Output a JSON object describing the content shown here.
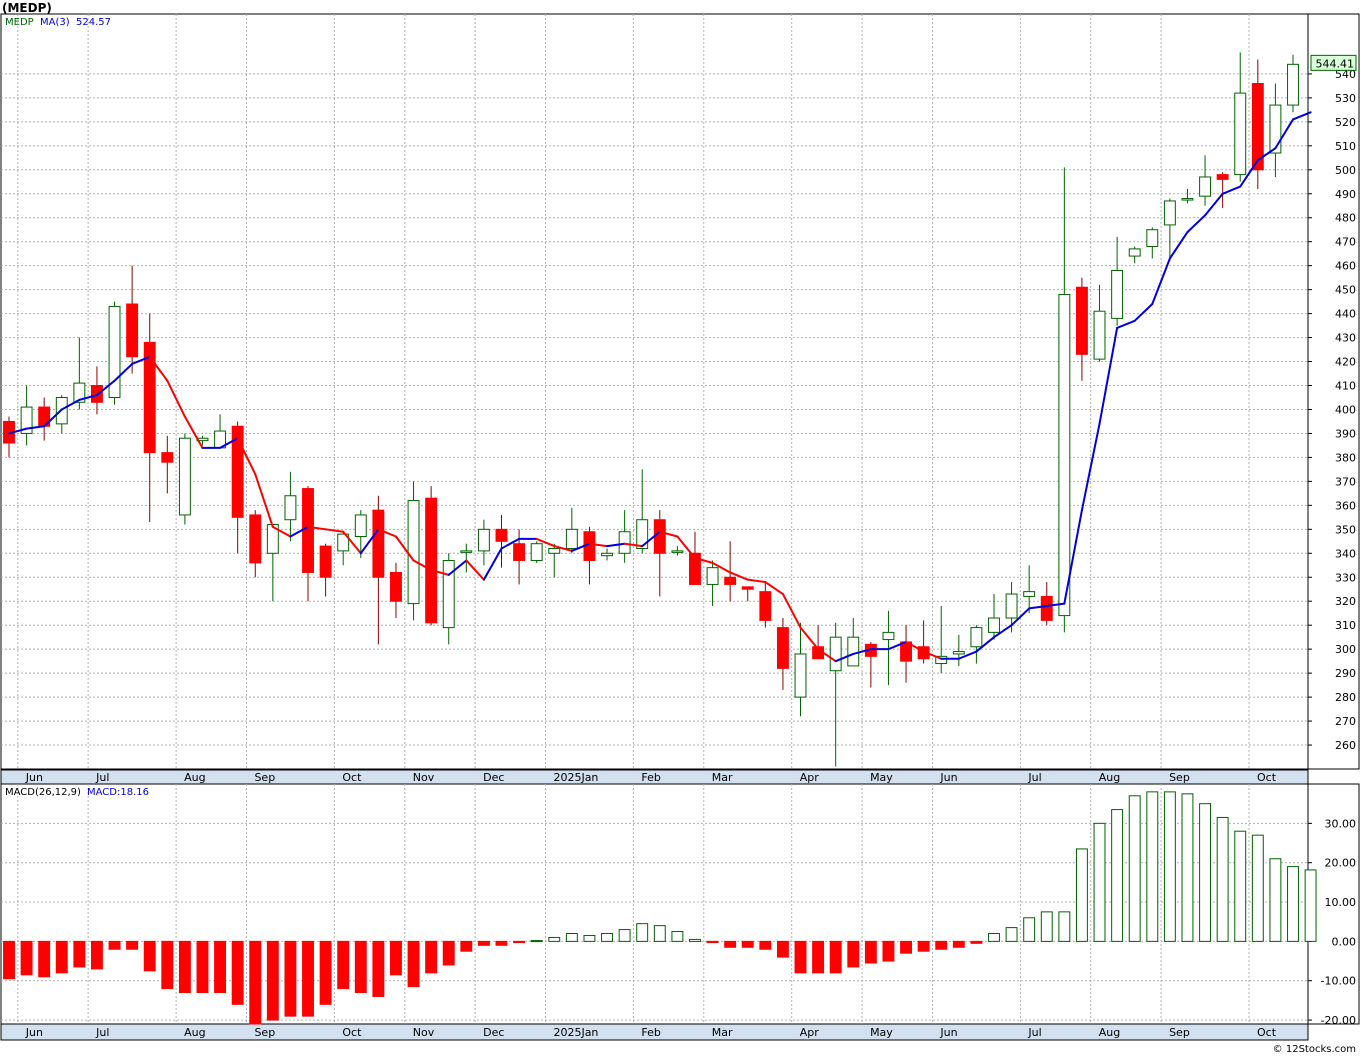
{
  "symbol_title": "(MEDP)",
  "credit": "© 12Stocks.com",
  "colors": {
    "up": "#006400",
    "down": "#ff0000",
    "ma_up": "#0000dd",
    "ma_down": "#ff0000",
    "grid": "#b0b0b0",
    "axis_band": "#d3e0f0",
    "last_price_box": "#d8ffd8"
  },
  "chart_data": [
    {
      "type": "candlestick",
      "ticker": "MEDP",
      "legend": {
        "symbol": "MEDP",
        "ma_label": "MA(3)",
        "ma_value": "524.57"
      },
      "last_price_label": "544.41",
      "ylim": [
        250,
        565
      ],
      "y_ticks": [
        260,
        270,
        280,
        290,
        300,
        310,
        320,
        330,
        340,
        350,
        360,
        370,
        380,
        390,
        400,
        410,
        420,
        430,
        440,
        450,
        460,
        470,
        480,
        490,
        500,
        510,
        520,
        530,
        540
      ],
      "months": [
        {
          "label": "Jun",
          "i": 1
        },
        {
          "label": "Jul",
          "i": 5
        },
        {
          "label": "Aug",
          "i": 10
        },
        {
          "label": "Sep",
          "i": 14
        },
        {
          "label": "Oct",
          "i": 19
        },
        {
          "label": "Nov",
          "i": 23
        },
        {
          "label": "Dec",
          "i": 27
        },
        {
          "label": "2025Jan",
          "i": 31
        },
        {
          "label": "Feb",
          "i": 36
        },
        {
          "label": "Mar",
          "i": 40
        },
        {
          "label": "Apr",
          "i": 45
        },
        {
          "label": "May",
          "i": 49
        },
        {
          "label": "Jun",
          "i": 53
        },
        {
          "label": "Jul",
          "i": 58
        },
        {
          "label": "Aug",
          "i": 62
        },
        {
          "label": "Sep",
          "i": 66
        },
        {
          "label": "Oct",
          "i": 71
        }
      ],
      "ohlc": [
        [
          395,
          397,
          380,
          386
        ],
        [
          390,
          410,
          385,
          401
        ],
        [
          401,
          405,
          387,
          393
        ],
        [
          394,
          406,
          390,
          405
        ],
        [
          403,
          430,
          400,
          411
        ],
        [
          410,
          418,
          398,
          403
        ],
        [
          405,
          445,
          402,
          443
        ],
        [
          444,
          460,
          415,
          422
        ],
        [
          428,
          440,
          353,
          382
        ],
        [
          382,
          389,
          365,
          378
        ],
        [
          356,
          390,
          352,
          388
        ],
        [
          387,
          389,
          385,
          388
        ],
        [
          384,
          398,
          385,
          391
        ],
        [
          393,
          395,
          340,
          355
        ],
        [
          356,
          358,
          330,
          336
        ],
        [
          340,
          352,
          320,
          352
        ],
        [
          354,
          374,
          345,
          364
        ],
        [
          367,
          368,
          320,
          332
        ],
        [
          343,
          344,
          322,
          330
        ],
        [
          341,
          349,
          335,
          348
        ],
        [
          347,
          358,
          338,
          356
        ],
        [
          358,
          364,
          302,
          330
        ],
        [
          332,
          336,
          313,
          320
        ],
        [
          319,
          370,
          312,
          362
        ],
        [
          363,
          368,
          310,
          311
        ],
        [
          309,
          340,
          302,
          337
        ],
        [
          341,
          344,
          332,
          341
        ],
        [
          341,
          354,
          335,
          350
        ],
        [
          350,
          356,
          334,
          345
        ],
        [
          344,
          350,
          327,
          337
        ],
        [
          337,
          345,
          336,
          344
        ],
        [
          340,
          344,
          330,
          342
        ],
        [
          342,
          359,
          340,
          350
        ],
        [
          349,
          351,
          327,
          337
        ],
        [
          339,
          342,
          337,
          340
        ],
        [
          340,
          358,
          336,
          349
        ],
        [
          342,
          375,
          340,
          354
        ],
        [
          354,
          358,
          322,
          340
        ],
        [
          341,
          343,
          339,
          341
        ],
        [
          340,
          349,
          330,
          327
        ],
        [
          327,
          337,
          318,
          334
        ],
        [
          330,
          345,
          320,
          327
        ],
        [
          326,
          326,
          320,
          325
        ],
        [
          324,
          328,
          309,
          312
        ],
        [
          309,
          313,
          283,
          292
        ],
        [
          280,
          311,
          272,
          298
        ],
        [
          301,
          310,
          297,
          296
        ],
        [
          291,
          311,
          251,
          305
        ],
        [
          293,
          313,
          293,
          305
        ],
        [
          302,
          303,
          284,
          297
        ],
        [
          304,
          316,
          285,
          307
        ],
        [
          303,
          310,
          286,
          295
        ],
        [
          301,
          312,
          294,
          296
        ],
        [
          294,
          318,
          290,
          297
        ],
        [
          298,
          306,
          293,
          299
        ],
        [
          301,
          310,
          294,
          309
        ],
        [
          307,
          323,
          304,
          313
        ],
        [
          313,
          328,
          307,
          323
        ],
        [
          322,
          335,
          315,
          324
        ],
        [
          322,
          328,
          310,
          312
        ],
        [
          314,
          501,
          307,
          448
        ],
        [
          451,
          455,
          412,
          423
        ],
        [
          421,
          452,
          420,
          441
        ],
        [
          438,
          472,
          435,
          458
        ],
        [
          464,
          468,
          461,
          467
        ],
        [
          468,
          476,
          463,
          475
        ],
        [
          477,
          488,
          462,
          487
        ],
        [
          488,
          492,
          486,
          488
        ],
        [
          489,
          506,
          485,
          497
        ],
        [
          498,
          499,
          484,
          496
        ],
        [
          498,
          549,
          495,
          532
        ],
        [
          536,
          546,
          492,
          500
        ],
        [
          507,
          536,
          497,
          527
        ],
        [
          527,
          548,
          524,
          544
        ]
      ],
      "ma3": [
        390,
        392,
        393,
        400,
        404,
        406,
        412,
        419,
        422,
        412,
        397,
        384,
        384,
        388,
        373,
        351,
        347,
        351,
        350,
        349,
        340,
        350,
        347,
        337,
        333,
        331,
        337,
        329,
        342,
        346,
        346,
        343,
        341,
        344,
        343,
        344,
        343,
        349,
        347,
        338,
        336,
        332,
        329,
        328,
        323,
        309,
        300,
        295,
        298,
        300,
        300,
        303,
        299,
        296,
        296,
        299,
        305,
        310,
        317,
        318,
        319,
        358,
        394,
        434,
        437,
        444,
        463,
        474,
        481,
        490,
        493,
        504,
        509,
        521,
        524
      ]
    },
    {
      "type": "histogram",
      "label": "MACD(26,12,9)",
      "value_label": "MACD:18.16",
      "ylim": [
        -21,
        40
      ],
      "y_ticks": [
        -20,
        -10,
        0,
        10,
        20,
        30
      ],
      "values": [
        -9.5,
        -8.5,
        -9,
        -8,
        -6.5,
        -7,
        -2,
        -2,
        -7.5,
        -12,
        -13,
        -13,
        -13,
        -16,
        -21,
        -20,
        -19,
        -19,
        -16,
        -12,
        -13,
        -14,
        -8.5,
        -11.5,
        -8,
        -6,
        -2.5,
        -1,
        -1,
        -0.3,
        0.2,
        1,
        2,
        1.5,
        2,
        3,
        4.5,
        4,
        2.5,
        0.5,
        -0.3,
        -1.5,
        -1.5,
        -2,
        -4,
        -8,
        -8,
        -8,
        -6.5,
        -5.5,
        -5,
        -3,
        -2.5,
        -2,
        -1.5,
        -0.5,
        2,
        3.5,
        6,
        7.5,
        7.5,
        23.5,
        30,
        33.5,
        37,
        38,
        38,
        37.5,
        35,
        31.5,
        28,
        27,
        21,
        19,
        18.16
      ]
    }
  ]
}
